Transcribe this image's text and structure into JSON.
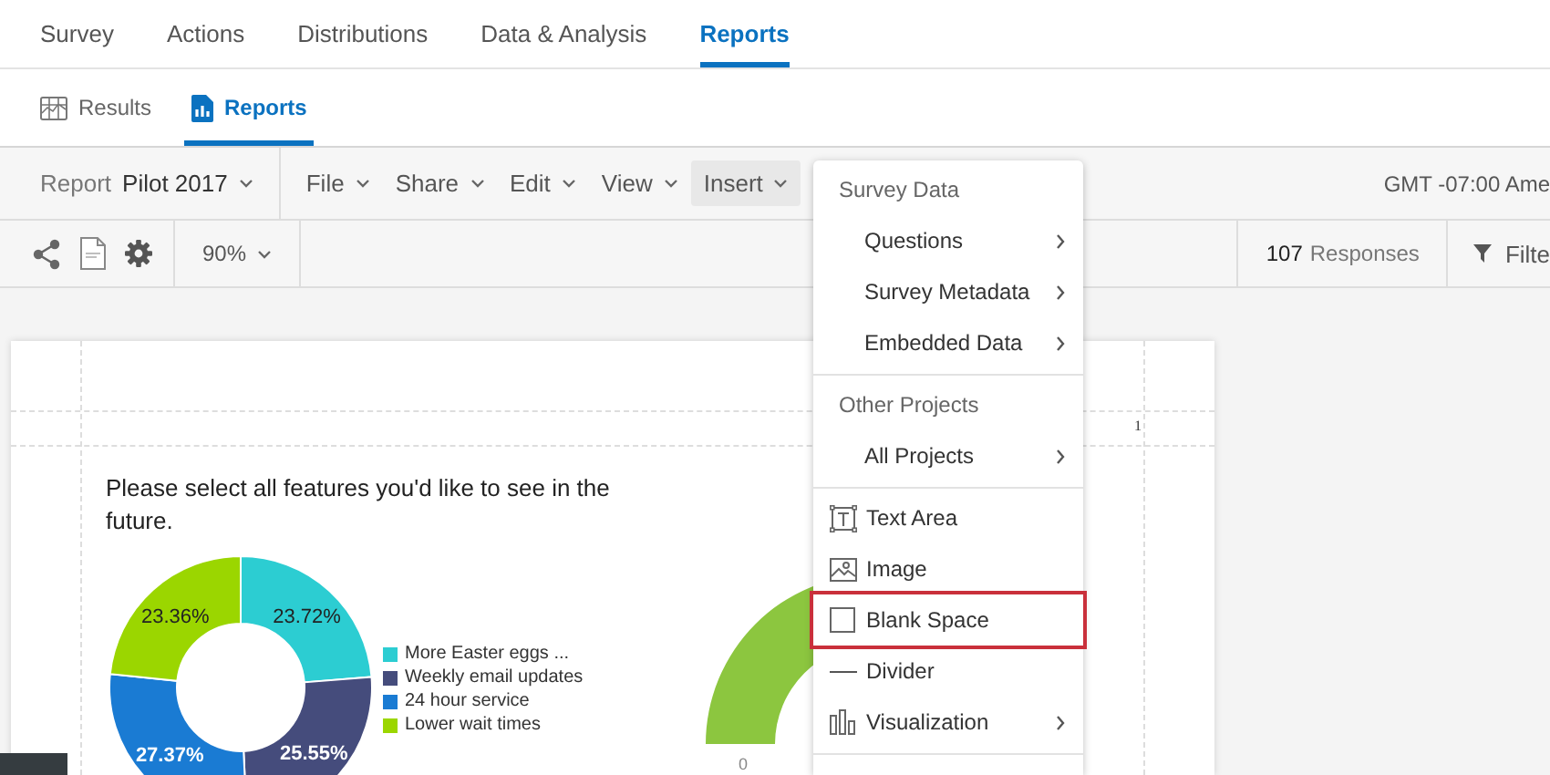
{
  "tabs": [
    {
      "label": "Survey",
      "selected": false
    },
    {
      "label": "Actions",
      "selected": false
    },
    {
      "label": "Distributions",
      "selected": false
    },
    {
      "label": "Data & Analysis",
      "selected": false
    },
    {
      "label": "Reports",
      "selected": true
    }
  ],
  "subtabs": [
    {
      "label": "Results",
      "kind": "image",
      "selected": false
    },
    {
      "label": "Reports",
      "kind": "document",
      "selected": true
    }
  ],
  "toolbar": {
    "report_label": "Report",
    "report_name": "Pilot 2017",
    "menus": [
      {
        "label": "File",
        "selected": false
      },
      {
        "label": "Share",
        "selected": false
      },
      {
        "label": "Edit",
        "selected": false
      },
      {
        "label": "View",
        "selected": false
      },
      {
        "label": "Insert",
        "selected": true
      }
    ],
    "timezone": "GMT -07:00 Ame"
  },
  "toolbar2": {
    "zoom": "90%",
    "responses_count": "107",
    "responses_label": "Responses",
    "filter_label": "Filte"
  },
  "report": {
    "page_number": "1",
    "chart": {
      "title": "Please select all features you'd like to see in the future.",
      "chart_data": {
        "type": "donut",
        "categories": [
          "More Easter eggs ...",
          "Weekly email updates",
          "24 hour service",
          "Lower wait times"
        ],
        "values": [
          23.72,
          25.55,
          27.37,
          23.36
        ],
        "legend": "right",
        "colors": [
          "#2ccdd2",
          "#454c7c",
          "#1a7bd3",
          "#9bd600"
        ],
        "value_labels": [
          "23.72%",
          "25.55%",
          "27.37%",
          "23.36%"
        ]
      }
    },
    "gauge": {
      "tick": "0"
    }
  },
  "insert_menu": {
    "sections": [
      {
        "heading": "Survey Data",
        "items": [
          {
            "label": "Questions",
            "kind": "plain",
            "submenu": true,
            "highlighted": false
          },
          {
            "label": "Survey Metadata",
            "kind": "plain",
            "submenu": true,
            "highlighted": false
          },
          {
            "label": "Embedded Data",
            "kind": "plain",
            "submenu": true,
            "highlighted": false
          }
        ]
      },
      {
        "heading": "Other Projects",
        "items": [
          {
            "label": "All Projects",
            "kind": "plain",
            "submenu": true,
            "highlighted": false
          }
        ]
      },
      {
        "items": [
          {
            "label": "Text Area",
            "kind": "textbox",
            "submenu": false,
            "highlighted": false
          },
          {
            "label": "Image",
            "kind": "image",
            "submenu": false,
            "highlighted": false
          },
          {
            "label": "Blank Space",
            "kind": "blank",
            "submenu": false,
            "highlighted": true
          },
          {
            "label": "Divider",
            "kind": "line",
            "submenu": false,
            "highlighted": false
          },
          {
            "label": "Visualization",
            "kind": "chart",
            "submenu": true,
            "highlighted": false
          }
        ]
      }
    ]
  }
}
